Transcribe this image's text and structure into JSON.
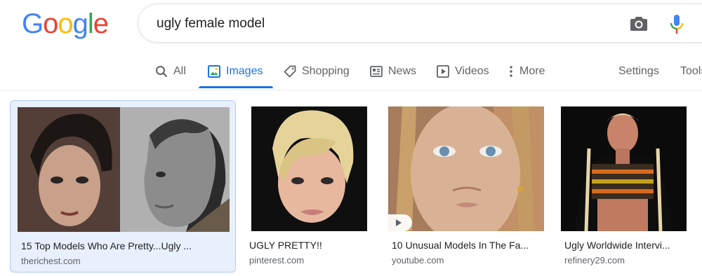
{
  "logo": {
    "letters": [
      "G",
      "o",
      "o",
      "g",
      "l",
      "e"
    ]
  },
  "search": {
    "query": "ugly female model"
  },
  "icons": {
    "camera": "camera-icon",
    "mic": "mic-icon"
  },
  "tabs": [
    {
      "label": "All",
      "icon": "search-icon",
      "active": false
    },
    {
      "label": "Images",
      "icon": "image-icon",
      "active": true
    },
    {
      "label": "Shopping",
      "icon": "tag-icon",
      "active": false
    },
    {
      "label": "News",
      "icon": "newspaper-icon",
      "active": false
    },
    {
      "label": "Videos",
      "icon": "play-icon",
      "active": false
    },
    {
      "label": "More",
      "icon": "more-vert-icon",
      "active": false
    }
  ],
  "tools": {
    "settings": "Settings",
    "tools": "Tools"
  },
  "results": [
    {
      "title": "15 Top Models Who Are Pretty...Ugly ...",
      "source": "therichest.com",
      "selected": true
    },
    {
      "title": "UGLY PRETTY!!",
      "source": "pinterest.com",
      "selected": false
    },
    {
      "title": "10 Unusual Models In The Fa...",
      "source": "youtube.com",
      "selected": false,
      "video": true
    },
    {
      "title": "Ugly Worldwide Intervi...",
      "source": "refinery29.com",
      "selected": false
    }
  ],
  "colors": {
    "accent": "#1a73e8",
    "logo_blue": "#4285f4",
    "logo_red": "#ea4335",
    "logo_yellow": "#fbbc05",
    "logo_green": "#34a853"
  }
}
